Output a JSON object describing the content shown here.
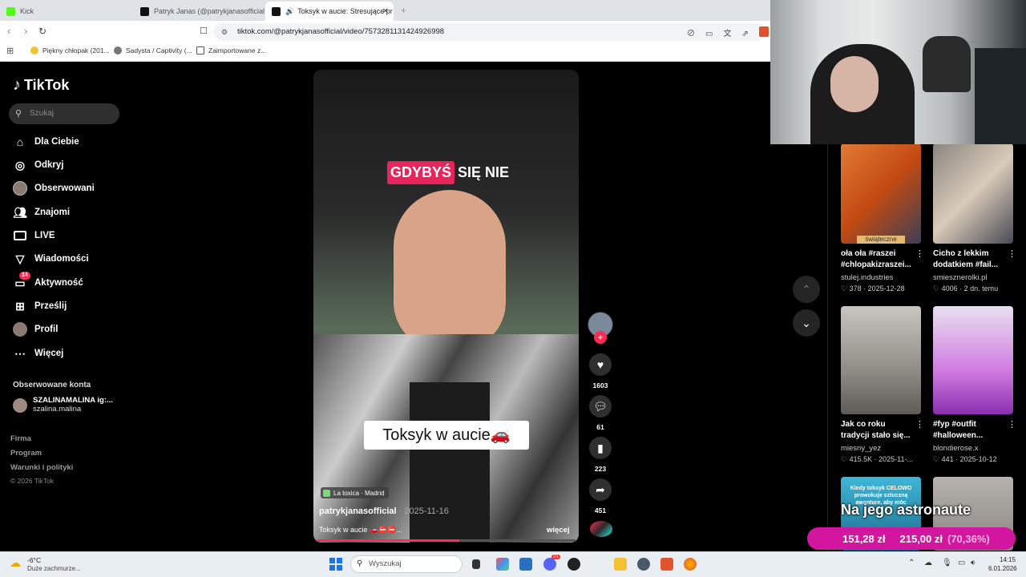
{
  "browser": {
    "tabs": [
      {
        "title": "Kick",
        "favicon_color": "#53fc18"
      },
      {
        "title": "Patryk Janas (@patrykjanasofficial) | T",
        "favicon_color": "#111111"
      },
      {
        "title": "Toksyk w aucie: Stresujące pr",
        "favicon_color": "#111111",
        "active": true
      }
    ],
    "new_tab": "+",
    "url": "tiktok.com/@patrykjanasofficial/video/7573281131424926998",
    "bookmarks": [
      "Piękny chłopak (201...",
      "Sadysta / Captivity (...",
      "Zaimportowane z..."
    ]
  },
  "sidebar": {
    "logo": "TikTok",
    "search_placeholder": "Szukaj",
    "nav": [
      {
        "label": "Dla Ciebie",
        "icon": "home-icon"
      },
      {
        "label": "Odkryj",
        "icon": "compass-icon"
      },
      {
        "label": "Obserwowani",
        "icon": "avatar-icon"
      },
      {
        "label": "Znajomi",
        "icon": "friends-icon"
      },
      {
        "label": "LIVE",
        "icon": "live-icon"
      },
      {
        "label": "Wiadomości",
        "icon": "send-icon"
      },
      {
        "label": "Aktywność",
        "icon": "activity-icon",
        "badge": "14"
      },
      {
        "label": "Prześlij",
        "icon": "plus-square-icon"
      },
      {
        "label": "Profil",
        "icon": "profile-avatar-icon"
      },
      {
        "label": "Więcej",
        "icon": "more-dots-icon"
      }
    ],
    "followed_title": "Obserwowane konta",
    "followed_account": {
      "name": "SZALINAMALINA ig:...",
      "handle": "szalina.malina"
    },
    "footer_links": [
      "Firma",
      "Program",
      "Warunki i polityki"
    ],
    "copyright": "© 2026 TikTok"
  },
  "video": {
    "caption_top_highlight": "GDYBYŚ",
    "caption_top_rest": "SIĘ NIE",
    "caption_main": "Toksyk w aucie🚗",
    "location": "La toxica · Madrid",
    "author": "patrykjanasofficial",
    "date": " · 2025-11-16",
    "description": "Toksyk w aucie 🚗⛔⛔...",
    "more": "więcej",
    "progress": 0.55
  },
  "actions": {
    "follow": "+",
    "likes": "1603",
    "comments": "61",
    "saves": "223",
    "shares": "451"
  },
  "scroll": {
    "up": "⌃",
    "down": "⌄"
  },
  "recommended": [
    {
      "title": "oła oła #raszei #chlopakizraszei...",
      "author": "stulej.industries",
      "likes": "378",
      "date": "2025-12-28",
      "tag": "świąteczne",
      "bg": "#d9651e"
    },
    {
      "title": "Cicho z lekkim dodatkiem #fail...",
      "author": "smiesznerolki.pl",
      "likes": "4006",
      "date": "2 dn. temu",
      "bg": "#a8a29a"
    },
    {
      "title": "Jak co roku tradycji stało się...",
      "author": "miesny_yez",
      "likes": "415.5K",
      "date": "2025-11-...",
      "bg": "#c9c6c0"
    },
    {
      "title": "#fyp #outfit #halloween...",
      "author": "blondierose.x",
      "likes": "441",
      "date": "2025-10-12",
      "bg": "#c46ad6"
    },
    {
      "title": "Kiedy toksyk CELOWO prowokuje sztuczną awanture, aby móc",
      "bg": "#3fb6d8"
    },
    {
      "title": "",
      "bg": "#a9a5a2"
    }
  ],
  "overlay": {
    "title": "Na jego astronaute",
    "current": "151,28 zł",
    "goal": "215,00 zł",
    "percent": "(70,36%)"
  },
  "taskbar": {
    "temp": "-6°C",
    "weather": "Duże zachmurze...",
    "search_placeholder": "Wyszukaj",
    "time": "14:15",
    "date": "6.01.2026",
    "discord_badge": "21"
  }
}
